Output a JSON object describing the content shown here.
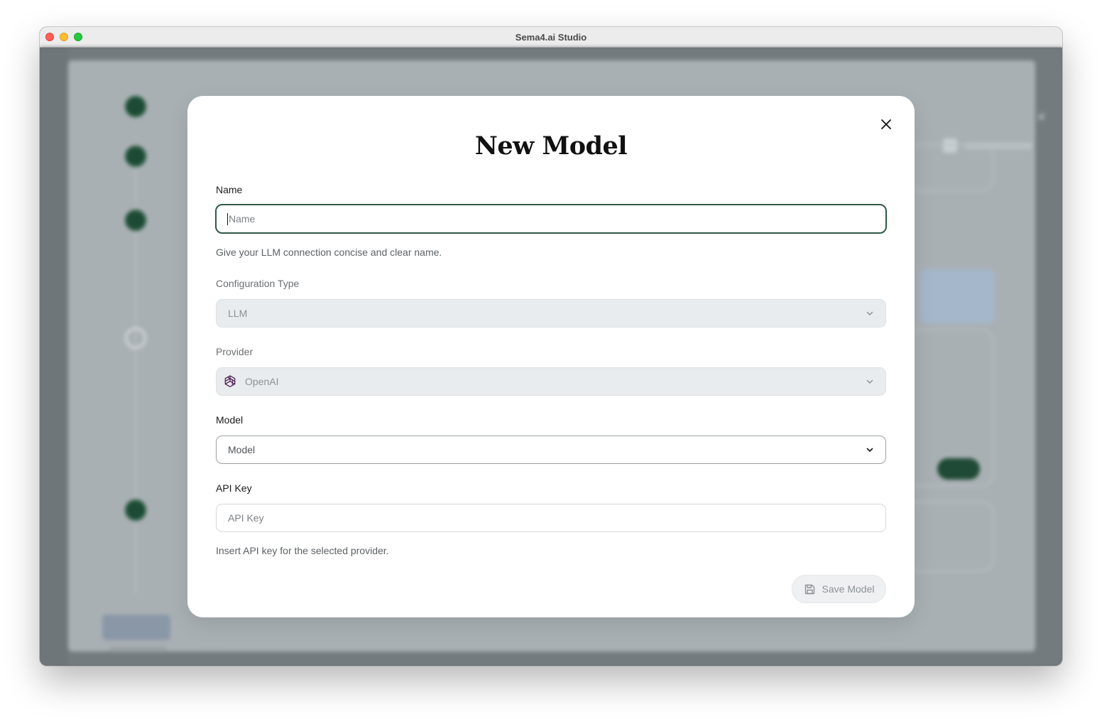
{
  "window": {
    "title": "Sema4.ai Studio"
  },
  "modal": {
    "title": "New Model",
    "fields": {
      "name": {
        "label": "Name",
        "placeholder": "Name",
        "value": "",
        "help": "Give your LLM connection concise and clear name."
      },
      "configuration_type": {
        "label": "Configuration Type",
        "selected": "LLM"
      },
      "provider": {
        "label": "Provider",
        "selected": "OpenAI",
        "icon": "openai-icon"
      },
      "model": {
        "label": "Model",
        "placeholder": "Model"
      },
      "api_key": {
        "label": "API Key",
        "placeholder": "API Key",
        "help": "Insert API key for the selected provider."
      }
    },
    "save_button": {
      "label": "Save Model",
      "icon": "save-icon"
    }
  },
  "colors": {
    "accent": "#2f5a45",
    "disabled_field": "#e9ecee",
    "overlay": "#747b7f"
  }
}
